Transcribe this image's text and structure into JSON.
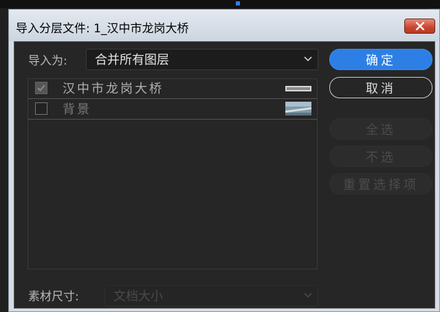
{
  "dialog": {
    "title": "导入分层文件: 1_汉中市龙岗大桥"
  },
  "import_as": {
    "label": "导入为:",
    "value": "合并所有图层"
  },
  "layers": [
    {
      "name": "汉中市龙岗大桥",
      "checked": true
    },
    {
      "name": "背景",
      "checked": false
    }
  ],
  "buttons": {
    "ok": "确定",
    "cancel": "取消",
    "select_all": "全选",
    "select_none": "不选",
    "reset": "重置选择项"
  },
  "footage_size": {
    "label": "素材尺寸:",
    "value": "文档大小"
  },
  "colors": {
    "accent": "#2d7fe6",
    "panel": "#262626"
  }
}
